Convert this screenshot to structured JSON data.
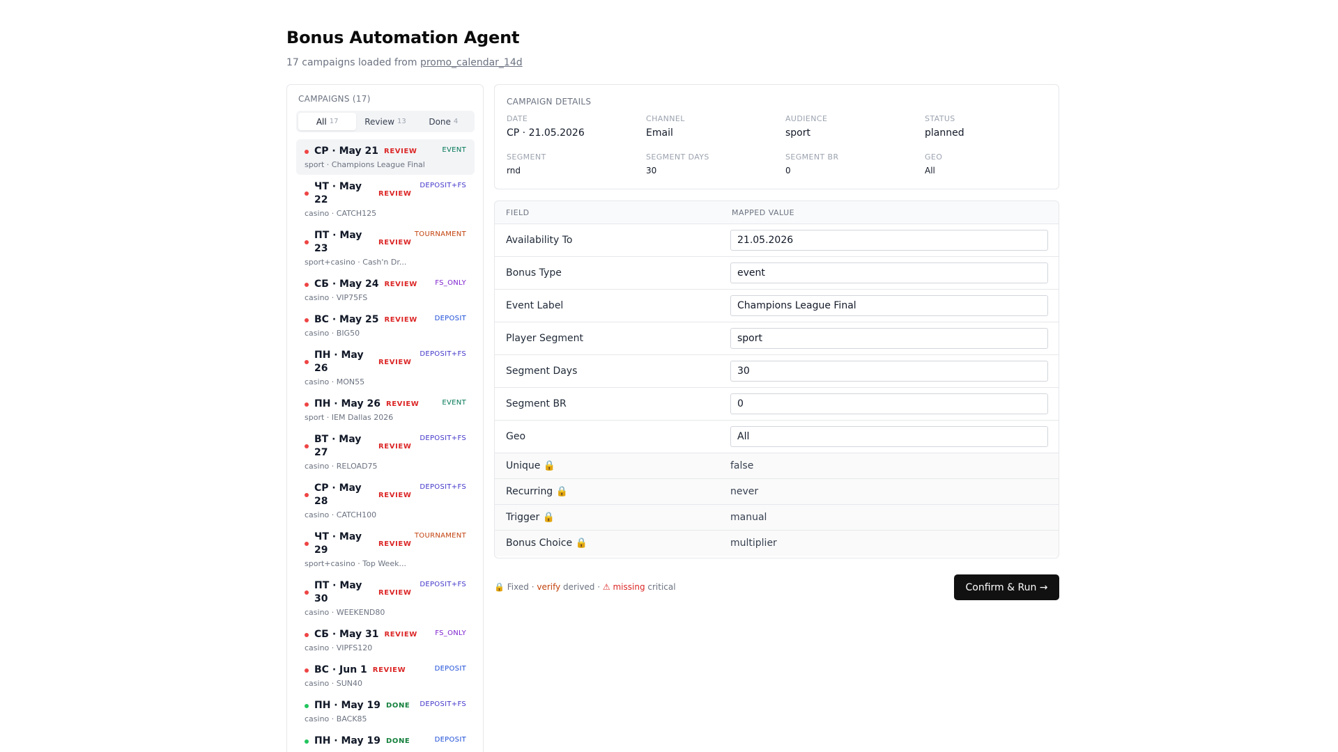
{
  "header": {
    "title": "Bonus Automation Agent",
    "subtitle_prefix": "17 campaigns loaded from",
    "source": "promo_calendar_14d"
  },
  "campaigns": {
    "title": "CAMPAIGNS (17)",
    "tabs": [
      {
        "label": "All",
        "count": "17",
        "active": true
      },
      {
        "label": "Review",
        "count": "13",
        "active": false
      },
      {
        "label": "Done",
        "count": "4",
        "active": false
      }
    ],
    "items": [
      {
        "date": "СР · May 21",
        "status": "REVIEW",
        "type": "EVENT",
        "type_color": "#047857",
        "sub": "sport · Champions League Final",
        "done": false,
        "active": true
      },
      {
        "date": "ЧТ · May 22",
        "status": "REVIEW",
        "type": "DEPOSIT+FS",
        "type_color": "#4338ca",
        "sub": "casino · CATCH125",
        "done": false
      },
      {
        "date": "ПТ · May 23",
        "status": "REVIEW",
        "type": "TOURNAMENT",
        "type_color": "#c2410c",
        "sub": "sport+casino · Cash'n Dr...",
        "done": false
      },
      {
        "date": "СБ · May 24",
        "status": "REVIEW",
        "type": "FS_ONLY",
        "type_color": "#7e22ce",
        "sub": "casino · VIP75FS",
        "done": false
      },
      {
        "date": "ВС · May 25",
        "status": "REVIEW",
        "type": "DEPOSIT",
        "type_color": "#1d4ed8",
        "sub": "casino · BIG50",
        "done": false
      },
      {
        "date": "ПН · May 26",
        "status": "REVIEW",
        "type": "DEPOSIT+FS",
        "type_color": "#4338ca",
        "sub": "casino · MON55",
        "done": false
      },
      {
        "date": "ПН · May 26",
        "status": "REVIEW",
        "type": "EVENT",
        "type_color": "#047857",
        "sub": "sport · IEM Dallas 2026",
        "done": false
      },
      {
        "date": "ВТ · May 27",
        "status": "REVIEW",
        "type": "DEPOSIT+FS",
        "type_color": "#4338ca",
        "sub": "casino · RELOAD75",
        "done": false
      },
      {
        "date": "СР · May 28",
        "status": "REVIEW",
        "type": "DEPOSIT+FS",
        "type_color": "#4338ca",
        "sub": "casino · CATCH100",
        "done": false
      },
      {
        "date": "ЧТ · May 29",
        "status": "REVIEW",
        "type": "TOURNAMENT",
        "type_color": "#c2410c",
        "sub": "sport+casino · Top Week...",
        "done": false
      },
      {
        "date": "ПТ · May 30",
        "status": "REVIEW",
        "type": "DEPOSIT+FS",
        "type_color": "#4338ca",
        "sub": "casino · WEEKEND80",
        "done": false
      },
      {
        "date": "СБ · May 31",
        "status": "REVIEW",
        "type": "FS_ONLY",
        "type_color": "#7e22ce",
        "sub": "casino · VIPFS120",
        "done": false
      },
      {
        "date": "ВС · Jun 1",
        "status": "REVIEW",
        "type": "DEPOSIT",
        "type_color": "#1d4ed8",
        "sub": "casino · SUN40",
        "done": false
      },
      {
        "date": "ПН · May 19",
        "status": "DONE",
        "type": "DEPOSIT+FS",
        "type_color": "#4338ca",
        "sub": "casino · BACK85",
        "done": true
      },
      {
        "date": "ПН · May 19",
        "status": "DONE",
        "type": "DEPOSIT",
        "type_color": "#1d4ed8",
        "sub": "",
        "done": true
      }
    ]
  },
  "details": {
    "title": "CAMPAIGN DETAILS",
    "fields": [
      {
        "label": "DATE",
        "value": "СР · 21.05.2026"
      },
      {
        "label": "CHANNEL",
        "value": "Email"
      },
      {
        "label": "AUDIENCE",
        "value": "sport"
      },
      {
        "label": "STATUS",
        "value": "planned"
      },
      {
        "label": "SEGMENT",
        "value": "rnd"
      },
      {
        "label": "SEGMENT DAYS",
        "value": "30"
      },
      {
        "label": "SEGMENT BR",
        "value": "0"
      },
      {
        "label": "GEO",
        "value": "All"
      }
    ]
  },
  "mapping": {
    "col_field": "FIELD",
    "col_value": "MAPPED VALUE",
    "editable": [
      {
        "field": "Availability To",
        "value": "21.05.2026"
      },
      {
        "field": "Bonus Type",
        "value": "event"
      },
      {
        "field": "Event Label",
        "value": "Champions League Final"
      },
      {
        "field": "Player Segment",
        "value": "sport"
      },
      {
        "field": "Segment Days",
        "value": "30"
      },
      {
        "field": "Segment BR",
        "value": "0"
      },
      {
        "field": "Geo",
        "value": "All"
      }
    ],
    "locked": [
      {
        "field": "Unique 🔒",
        "value": "false"
      },
      {
        "field": "Recurring 🔒",
        "value": "never"
      },
      {
        "field": "Trigger 🔒",
        "value": "manual"
      },
      {
        "field": "Bonus Choice 🔒",
        "value": "multiplier"
      }
    ]
  },
  "legend": {
    "fixed": "🔒 Fixed",
    "sep": "·",
    "verify": "verify",
    "derived": "derived",
    "missing": "⚠ missing",
    "critical": "critical"
  },
  "actions": {
    "confirm": "Confirm & Run →"
  }
}
